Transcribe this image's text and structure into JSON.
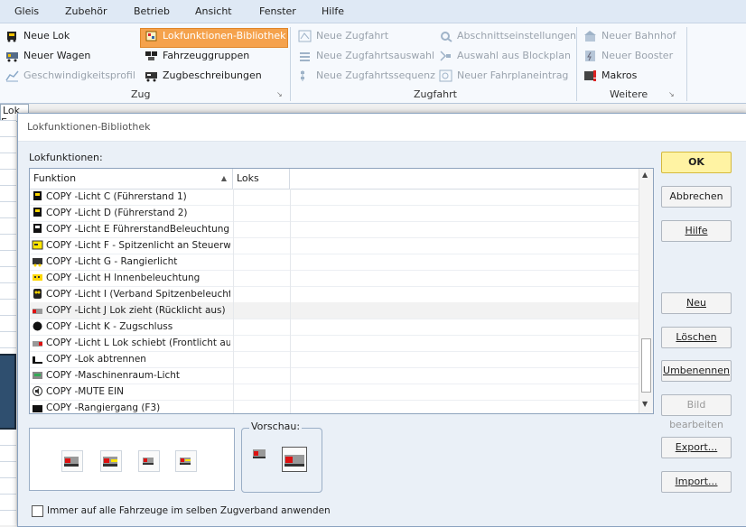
{
  "menu": [
    "Gleis",
    "Zubehör",
    "Betrieb",
    "Ansicht",
    "Fenster",
    "Hilfe"
  ],
  "ribbon": {
    "zug": {
      "label": "Zug",
      "items": [
        "Neue Lok",
        "Neuer Wagen",
        "Geschwindigkeitsprofil",
        "Lokfunktionen-Bibliothek",
        "Fahrzeuggruppen",
        "Zugbeschreibungen"
      ]
    },
    "zugfahrt": {
      "label": "Zugfahrt",
      "items": [
        "Neue Zugfahrt",
        "Neue Zugfahrtsauswahl",
        "Neue Zugfahrtssequenz",
        "Abschnittseinstellungen",
        "Auswahl aus Blockplan",
        "Neuer Fahrplaneintrag"
      ]
    },
    "weitere": {
      "label": "Weitere",
      "items": [
        "Neuer Bahnhof",
        "Neuer Booster",
        "Makros"
      ]
    }
  },
  "background_tab": "Lok E",
  "dialog": {
    "title": "Lokfunktionen-Bibliothek",
    "list_caption": "Lokfunktionen:",
    "columns": [
      "Funktion",
      "Loks"
    ],
    "rows": [
      "COPY -Licht C (Führerstand 1)",
      "COPY -Licht D (Führerstand 2)",
      "COPY -Licht E FührerstandBeleuchtung ...",
      "COPY -Licht F - Spitzenlicht an Steuerwa...",
      "COPY -Licht G - Rangierlicht",
      "COPY -Licht H Innenbeleuchtung",
      "COPY -Licht I (Verband Spitzenbeleuchtu...",
      "COPY -Licht J Lok zieht (Rücklicht aus)",
      "COPY -Licht K - Zugschluss",
      "COPY -Licht L Lok schiebt (Frontlicht aus)",
      "COPY -Lok abtrennen",
      "COPY -Maschinenraum-Licht",
      "COPY -MUTE EIN",
      "COPY -Rangiergang (F3)"
    ],
    "selected_row": "COPY -Licht J Lok zieht (Rücklicht aus)",
    "preview_label": "Vorschau:",
    "checkbox_label": "Immer auf alle Fahrzeuge im selben Zugverband anwenden",
    "buttons": {
      "ok": "OK",
      "cancel": "Abbrechen",
      "help": "Hilfe",
      "new": "Neu",
      "delete": "Löschen",
      "rename": "Umbenennen",
      "edit_image": "Bild bearbeiten",
      "export": "Export...",
      "import": "Import..."
    }
  },
  "colors": {
    "ribbon_highlight": "#f5a24c",
    "ok_button": "#fff3a3",
    "dialog_bg": "#eaf0f7"
  }
}
